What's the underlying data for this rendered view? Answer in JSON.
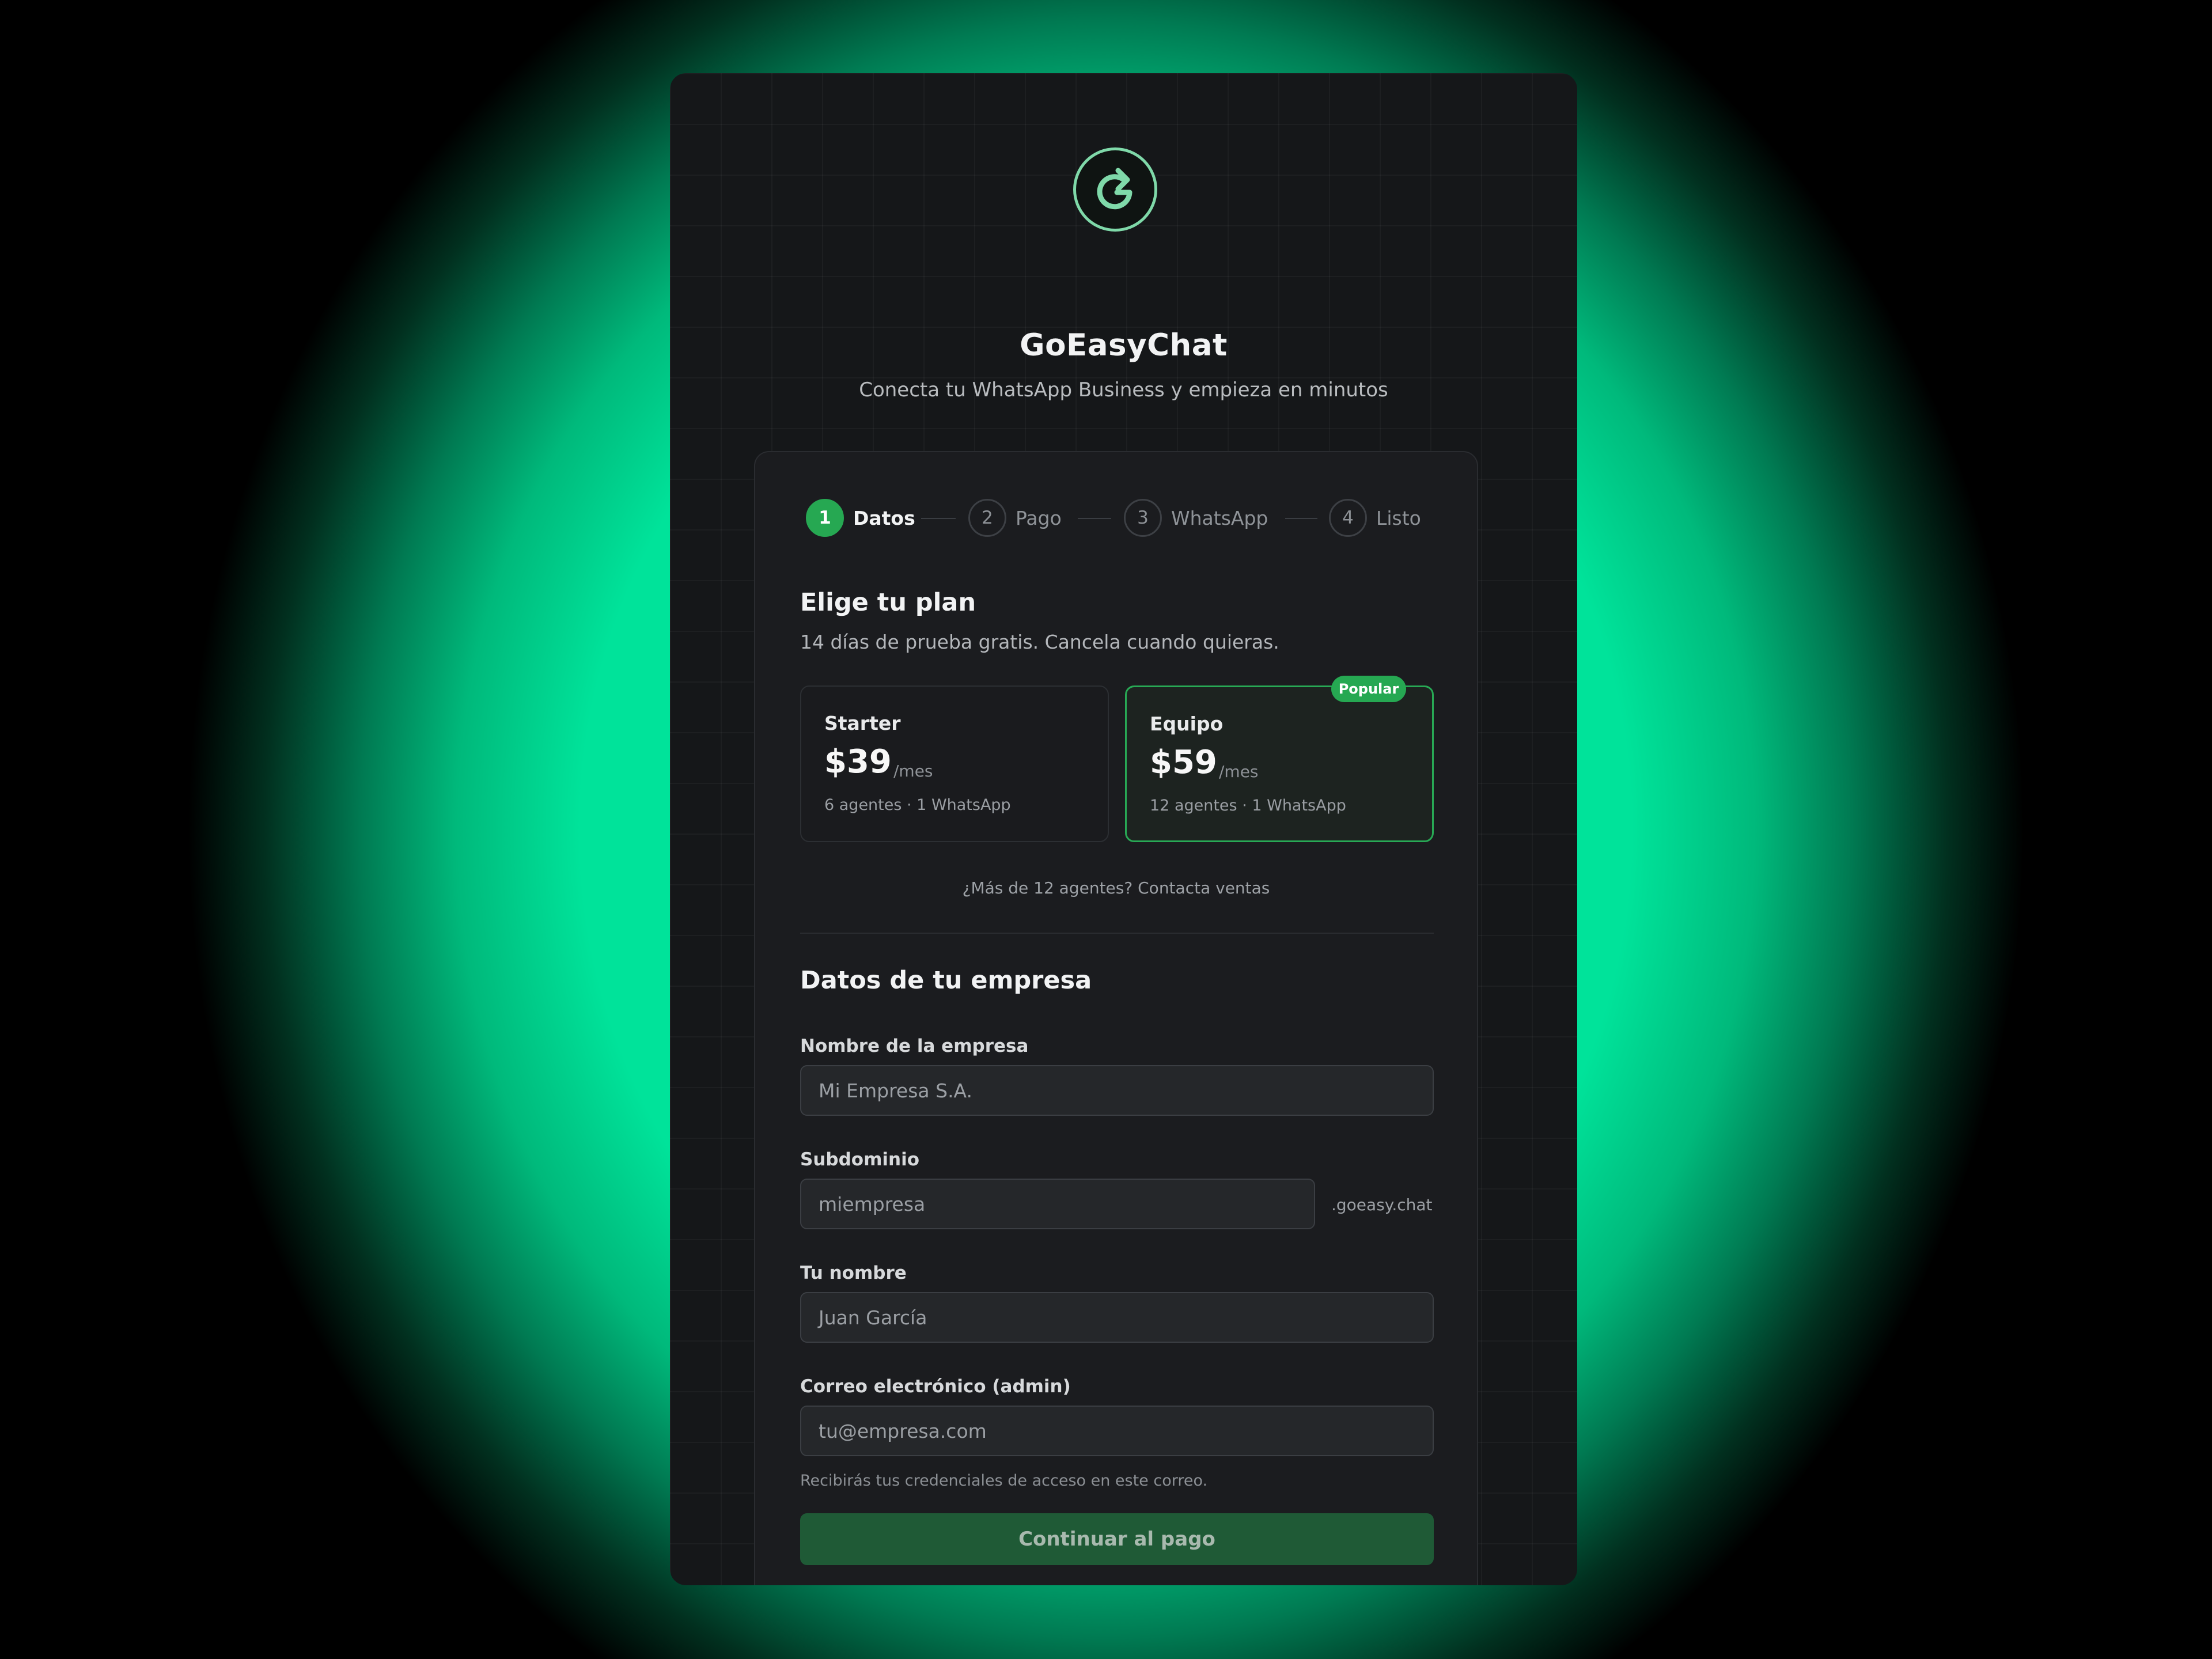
{
  "brand": {
    "name": "GoEasyChat",
    "tagline": "Conecta tu WhatsApp Business y empieza en minutos",
    "accent": "#26a852",
    "logo_icon": "refresh-arrow-icon"
  },
  "steps": [
    {
      "number": "1",
      "label": "Datos",
      "active": true
    },
    {
      "number": "2",
      "label": "Pago",
      "active": false
    },
    {
      "number": "3",
      "label": "WhatsApp",
      "active": false
    },
    {
      "number": "4",
      "label": "Listo",
      "active": false
    }
  ],
  "plan_section": {
    "title": "Elige tu plan",
    "subtitle": "14 días de prueba gratis. Cancela cuando quieras.",
    "plans": [
      {
        "name": "Starter",
        "price": "$39",
        "period": "/mes",
        "description": "6 agentes · 1 WhatsApp",
        "selected": false
      },
      {
        "name": "Equipo",
        "price": "$59",
        "period": "/mes",
        "description": "12 agentes · 1 WhatsApp",
        "selected": true,
        "badge": "Popular"
      }
    ],
    "contact_text": "¿Más de 12 agentes? Contacta ventas"
  },
  "company_section": {
    "title": "Datos de tu empresa",
    "fields": {
      "company_name": {
        "label": "Nombre de la empresa",
        "placeholder": "Mi Empresa S.A.",
        "value": ""
      },
      "subdomain": {
        "label": "Subdominio",
        "placeholder": "miempresa",
        "value": "",
        "suffix": ".goeasy.chat"
      },
      "your_name": {
        "label": "Tu nombre",
        "placeholder": "Juan García",
        "value": ""
      },
      "email": {
        "label": "Correo electrónico (admin)",
        "placeholder": "tu@empresa.com",
        "value": "",
        "hint": "Recibirás tus credenciales de acceso en este correo."
      }
    },
    "submit_label": "Continuar al pago"
  }
}
